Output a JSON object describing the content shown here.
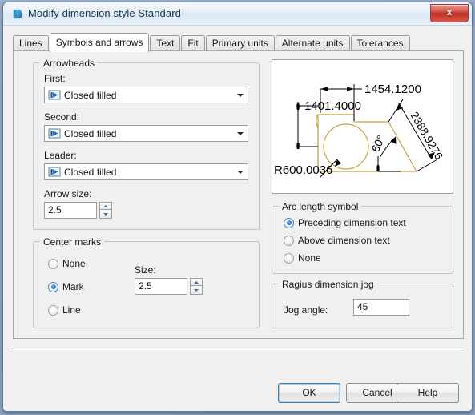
{
  "window": {
    "title": "Modify dimension style Standard",
    "icon": "autocad-dimension-icon",
    "close_label": "x"
  },
  "tabs": [
    {
      "label": "Lines",
      "active": false
    },
    {
      "label": "Symbols and arrows",
      "active": true
    },
    {
      "label": "Text",
      "active": false
    },
    {
      "label": "Fit",
      "active": false
    },
    {
      "label": "Primary units",
      "active": false
    },
    {
      "label": "Alternate units",
      "active": false
    },
    {
      "label": "Tolerances",
      "active": false
    }
  ],
  "arrowheads": {
    "legend": "Arrowheads",
    "first": {
      "label": "First:",
      "value": "Closed filled",
      "icon": "arrowhead-closed-filled-icon"
    },
    "second": {
      "label": "Second:",
      "value": "Closed filled",
      "icon": "arrowhead-closed-filled-icon"
    },
    "leader": {
      "label": "Leader:",
      "value": "Closed filled",
      "icon": "arrowhead-closed-filled-icon"
    },
    "arrow_size": {
      "label": "Arrow size:",
      "value": "2.5"
    }
  },
  "center_marks": {
    "legend": "Center marks",
    "options": [
      {
        "label": "None",
        "selected": false
      },
      {
        "label": "Mark",
        "selected": true
      },
      {
        "label": "Line",
        "selected": false
      }
    ],
    "size": {
      "label": "Size:",
      "value": "2.5"
    }
  },
  "arc_length_symbol": {
    "legend": "Arc length symbol",
    "options": [
      {
        "label": "Preceding dimension text",
        "selected": true
      },
      {
        "label": "Above dimension text",
        "selected": false
      },
      {
        "label": "None",
        "selected": false
      }
    ]
  },
  "radius_dimension_jog": {
    "legend": "Ragius dimension jog",
    "jog_angle": {
      "label": "Jog angle:",
      "value": "45"
    }
  },
  "preview": {
    "name": "dimension-style-preview",
    "dim_top": "1454.1200",
    "dim_left_top": "1401.4000",
    "dim_radius": "R600.0036",
    "dim_angle": "60°",
    "dim_diagonal": "2388.9276",
    "geometry_color": "#c8a34a",
    "dimension_color": "#000000"
  },
  "footer": {
    "ok": "OK",
    "cancel": "Cancel",
    "help": "Help"
  },
  "colors": {
    "accent": "#3c7fb1",
    "dialog_bg": "#f0f0f0",
    "close_red": "#bf3326"
  }
}
